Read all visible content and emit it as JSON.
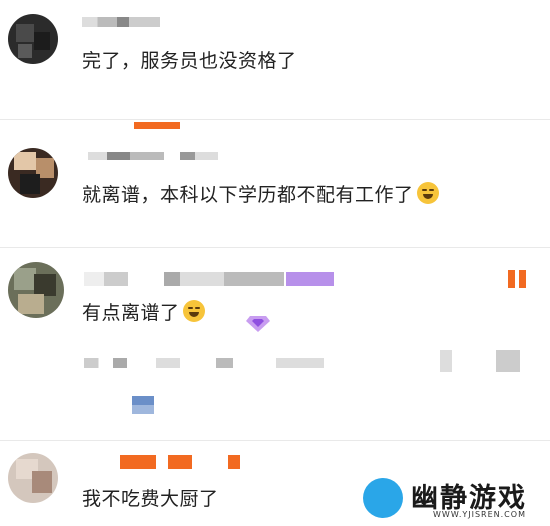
{
  "comments": [
    {
      "text": "完了，服务员也没资格了",
      "emoji": ""
    },
    {
      "text": "就离谱，本科以下学历都不配有工作了",
      "emoji": "sweat-emoji"
    },
    {
      "text": "有点离谱了",
      "emoji": "laugh-cry-emoji",
      "badge": "gem-badge-icon"
    },
    {
      "text": "我不吃费大厨了",
      "emoji": ""
    }
  ],
  "watermark": {
    "title": "幽静游戏",
    "url": "WWW.YJISREN.COM"
  },
  "colors": {
    "accent_orange": "#f26a21",
    "accent_purple": "#b790ea",
    "text": "#222222",
    "divider": "#e9e9e9"
  }
}
